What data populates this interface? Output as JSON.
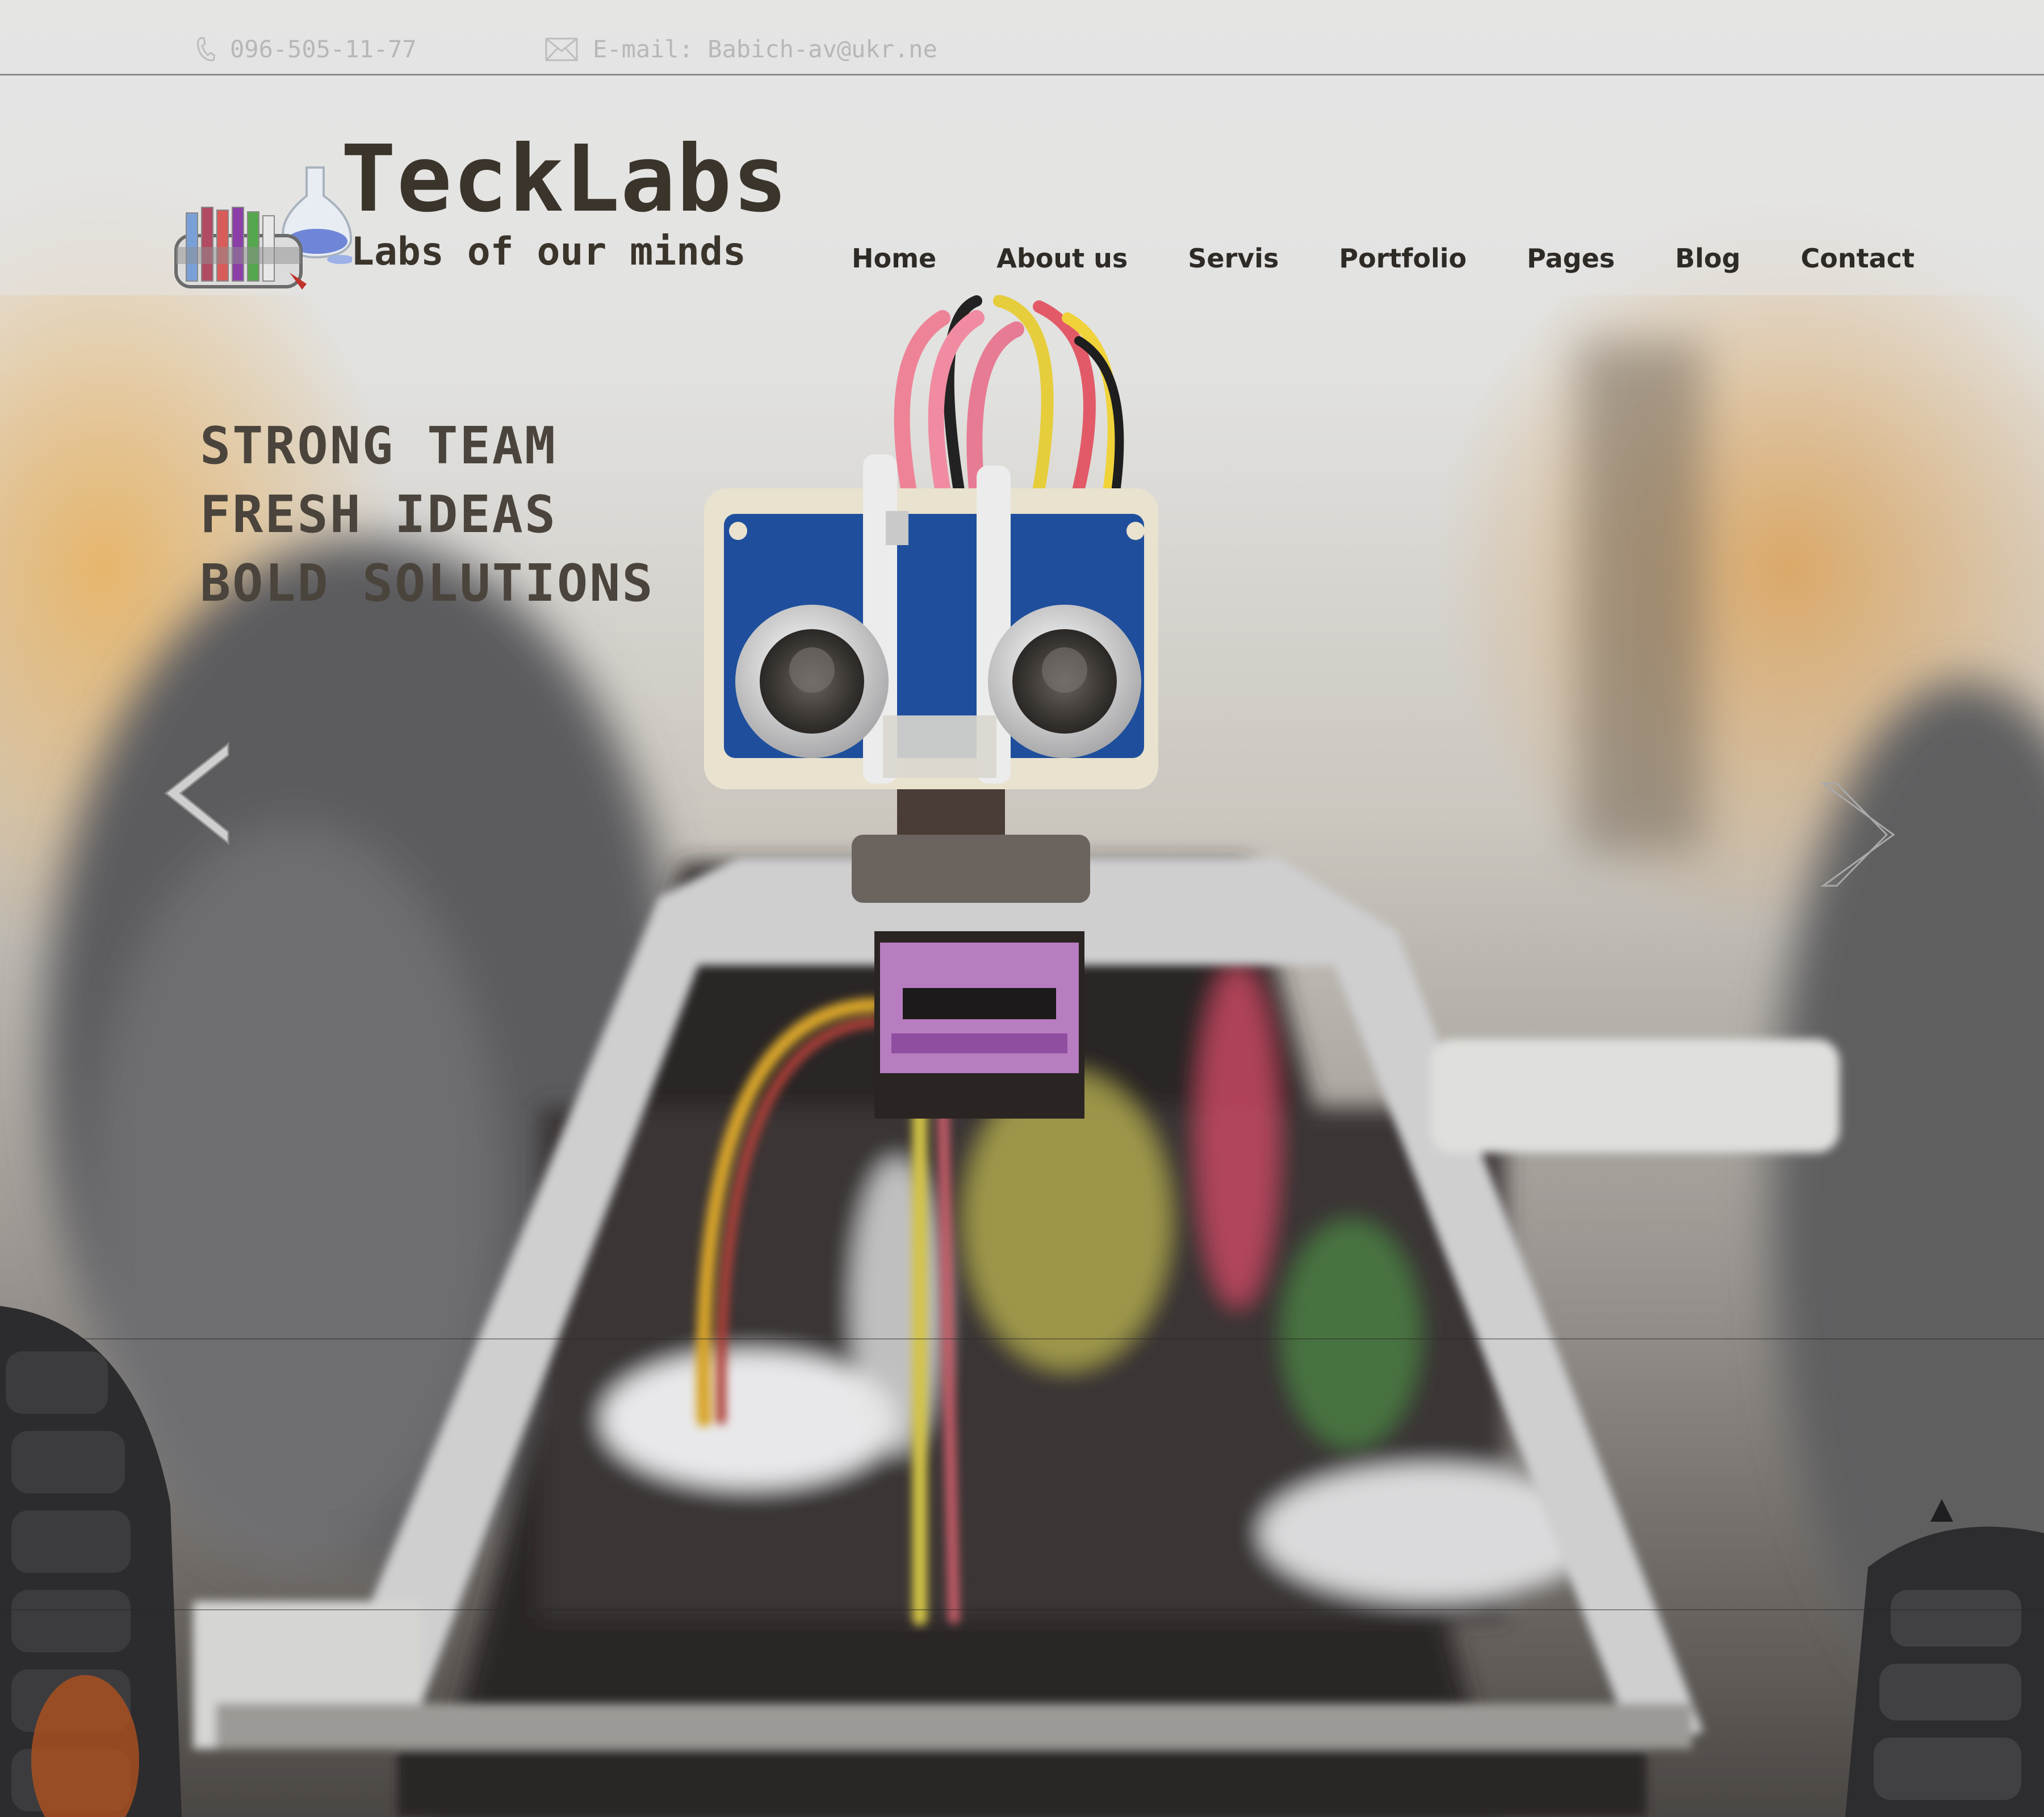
{
  "topbar": {
    "phone": "096-505-11-77",
    "email": "E-mail: Babich-av@ukr.ne",
    "phone_icon": "phone-icon",
    "email_icon": "envelope-icon"
  },
  "logo": {
    "brand": "TeckLabs",
    "tagline": "Labs of our minds",
    "icon": "lab-flasks-logo"
  },
  "nav": {
    "items": [
      "Home",
      "About us",
      "Servis",
      "Portfolio",
      "Pages",
      "Blog",
      "Contact"
    ]
  },
  "hero": {
    "slogan": [
      "STRONG TEAM",
      "FRESH IDEAS",
      "BOLD SOLUTIONS"
    ],
    "prev_icon": "chevron-left-icon",
    "next_icon": "chevron-right-icon"
  },
  "colors": {
    "brand_text": "#3a342b",
    "nav_text": "#2e2a25",
    "topbar_text": "#b7b7b7"
  }
}
